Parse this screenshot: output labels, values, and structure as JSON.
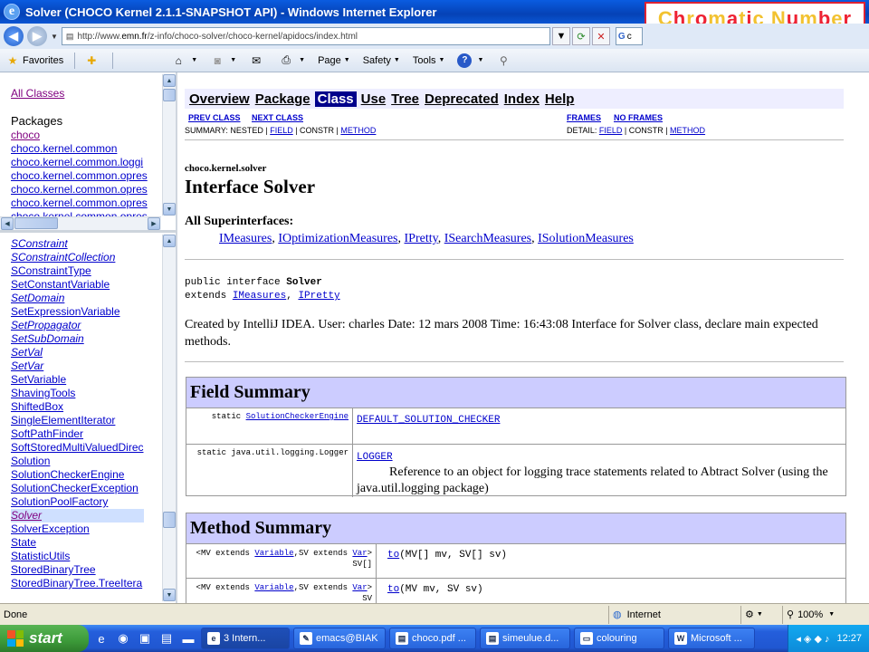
{
  "window": {
    "title": "Solver (CHOCO Kernel 2.1.1-SNAPSHOT API) - Windows Internet Explorer",
    "overlay_text": "Chromatic Number"
  },
  "address": {
    "url_prefix": "http://www.",
    "url_site": "emn.fr",
    "url_rest": "/z-info/choco-solver/choco-kernel/apidocs/index.html",
    "search_text": "c"
  },
  "commandbar": {
    "favorites": "Favorites",
    "page": "Page",
    "safety": "Safety",
    "tools": "Tools"
  },
  "left_top": {
    "all_classes": "All Classes",
    "packages_heading": "Packages",
    "packages": [
      "choco",
      "choco.kernel.common",
      "choco.kernel.common.loggi",
      "choco.kernel.common.opres",
      "choco.kernel.common.opres",
      "choco.kernel.common.opres",
      "choco.kernel.common.opres"
    ]
  },
  "left_classes": [
    {
      "name": "SConstraint",
      "italic": true
    },
    {
      "name": "SConstraintCollection",
      "italic": true
    },
    {
      "name": "SConstraintType",
      "italic": false
    },
    {
      "name": "SetConstantVariable",
      "italic": false
    },
    {
      "name": "SetDomain",
      "italic": true
    },
    {
      "name": "SetExpressionVariable",
      "italic": false
    },
    {
      "name": "SetPropagator",
      "italic": true
    },
    {
      "name": "SetSubDomain",
      "italic": true
    },
    {
      "name": "SetVal",
      "italic": true
    },
    {
      "name": "SetVar",
      "italic": true
    },
    {
      "name": "SetVariable",
      "italic": false
    },
    {
      "name": "ShavingTools",
      "italic": false
    },
    {
      "name": "ShiftedBox",
      "italic": false
    },
    {
      "name": "SingleElementIterator",
      "italic": false
    },
    {
      "name": "SoftPathFinder",
      "italic": false
    },
    {
      "name": "SoftStoredMultiValuedDirec",
      "italic": false
    },
    {
      "name": "Solution",
      "italic": false
    },
    {
      "name": "SolutionCheckerEngine",
      "italic": false
    },
    {
      "name": "SolutionCheckerException",
      "italic": false
    },
    {
      "name": "SolutionPoolFactory",
      "italic": false
    },
    {
      "name": "Solver",
      "italic": true,
      "selected": true
    },
    {
      "name": "SolverException",
      "italic": false
    },
    {
      "name": "State",
      "italic": false
    },
    {
      "name": "StatisticUtils",
      "italic": false
    },
    {
      "name": "StoredBinaryTree",
      "italic": false
    },
    {
      "name": "StoredBinaryTree.TreeItera",
      "italic": false
    }
  ],
  "nav": {
    "items": [
      "Overview",
      "Package",
      "Class",
      "Use",
      "Tree",
      "Deprecated",
      "Index",
      "Help"
    ],
    "active": "Class",
    "prev_class": "PREV CLASS",
    "next_class": "NEXT CLASS",
    "frames": "FRAMES",
    "no_frames": "NO FRAMES",
    "summary_prefix": "SUMMARY: NESTED | ",
    "summary_field": "FIELD",
    "summary_mid": " | CONSTR | ",
    "summary_method": "METHOD",
    "detail_prefix": "DETAIL: ",
    "detail_field": "FIELD",
    "detail_mid": " | CONSTR | ",
    "detail_method": "METHOD"
  },
  "doc": {
    "package": "choco.kernel.solver",
    "interface_title": "Interface Solver",
    "superinterfaces_heading": "All Superinterfaces:",
    "superinterfaces": [
      "IMeasures",
      "IOptimizationMeasures",
      "IPretty",
      "ISearchMeasures",
      "ISolutionMeasures"
    ],
    "decl_line1_prefix": "public interface ",
    "decl_line1_name": "Solver",
    "decl_line2_prefix": "extends ",
    "decl_ext1": "IMeasures",
    "decl_ext2": "IPretty",
    "description_line1": "Created by IntelliJ IDEA. User: charles Date: 12 mars 2008 Time: 16:43:08 Interface for Solver class, declare main expected",
    "description_line2": "methods."
  },
  "field_summary": {
    "title": "Field Summary",
    "rows": [
      {
        "modifier": "static ",
        "type": "SolutionCheckerEngine",
        "name": "DEFAULT_SOLUTION_CHECKER",
        "desc1": "",
        "desc2": ""
      },
      {
        "modifier": "static java.util.logging.Logger",
        "type": "",
        "name": "LOGGER",
        "desc1": "Reference to an object for logging trace statements related to Abtract Solver (using the",
        "desc2": "java.util.logging package)"
      }
    ]
  },
  "method_summary": {
    "title": "Method Summary",
    "rows": [
      {
        "prefix": "<MV extends ",
        "t1": "Variable",
        "mid": ",SV extends ",
        "t2": "Var",
        "suffix": ">",
        "ret": "SV[]",
        "name": "to",
        "sig": "(MV[] mv, SV[] sv)"
      },
      {
        "prefix": "<MV extends ",
        "t1": "Variable",
        "mid": ",SV extends ",
        "t2": "Var",
        "suffix": ">",
        "ret": "SV",
        "name": "to",
        "sig": "(MV mv, SV sv)"
      }
    ]
  },
  "status": {
    "left": "Done",
    "zone": "Internet",
    "zoom": "100%"
  },
  "taskbar": {
    "start": "start",
    "buttons": [
      "3 Intern...",
      "emacs@BIAK",
      "choco.pdf ...",
      "simeulue.d...",
      "colouring",
      "Microsoft ..."
    ],
    "clock": "12:27"
  },
  "colors": {
    "overlay_yellow": "#f2c230",
    "overlay_red": "#ee2233",
    "table_header": "#ccccff",
    "navbar_bg": "#eeeeff",
    "active_nav": "#00008b",
    "link": "#0000cc"
  }
}
